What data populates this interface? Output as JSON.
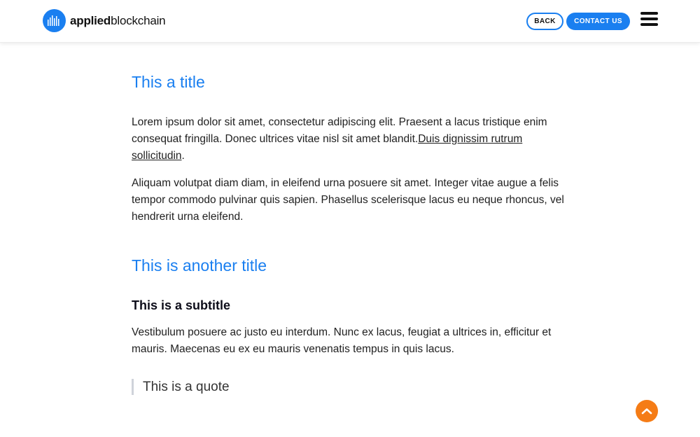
{
  "header": {
    "logo_bold": "applied",
    "logo_light": "blockchain",
    "back_label": "BACK",
    "contact_label": "CONTACT US"
  },
  "article": {
    "title1": "This a title",
    "para1_text": "Lorem ipsum dolor sit amet, consectetur adipiscing elit. Praesent a lacus tristique enim consequat fringilla. Donec ultrices vitae nisl sit amet blandit.",
    "para1_link": "Duis dignissim rutrum sollicitudin",
    "para1_end": ".",
    "para2": "Aliquam volutpat diam diam, in eleifend urna posuere sit amet. Integer vitae augue a felis tempor commodo pulvinar quis sapien. Phasellus scelerisque lacus eu neque rhoncus, vel hendrerit urna eleifend.",
    "title2": "This is another title",
    "subtitle": "This is a subtitle",
    "para3": "Vestibulum posuere ac justo eu interdum. Nunc ex lacus, feugiat a ultrices in, efficitur et mauris. Maecenas eu ex eu mauris venenatis tempus in quis lacus.",
    "quote": "This is a quote"
  },
  "colors": {
    "accent": "#1a7ff0",
    "scroll_button": "#f57c16"
  },
  "icons": {
    "logo": "bars-circle-icon",
    "menu": "hamburger-icon",
    "scroll_top": "chevron-up-icon"
  }
}
